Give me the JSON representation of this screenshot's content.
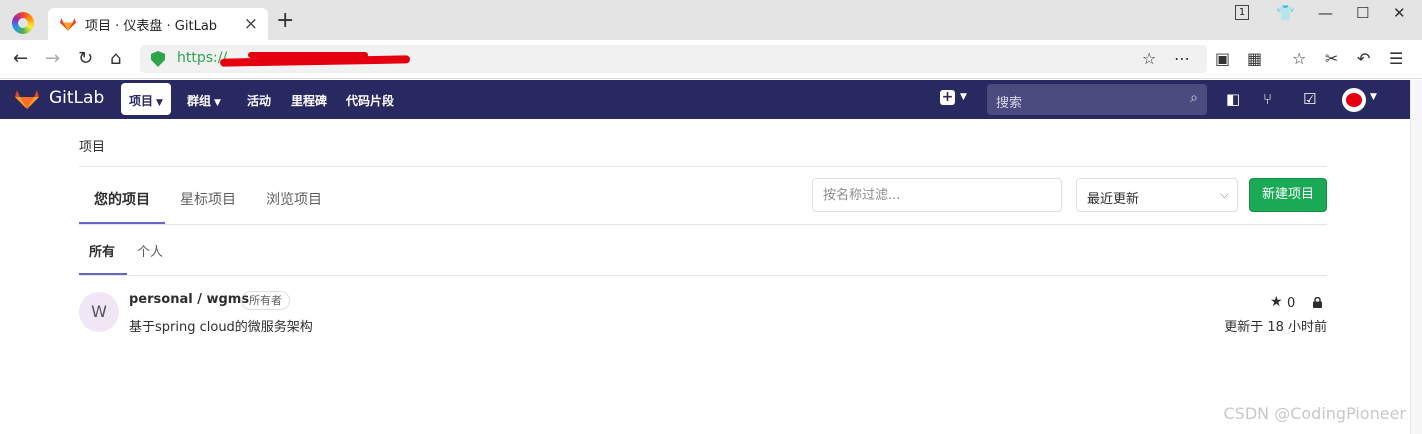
{
  "browser": {
    "tab_title": "项目 · 仪表盘 · GitLab",
    "url": "https://",
    "window_badge": "1"
  },
  "gitlab_nav": {
    "brand": "GitLab",
    "items": [
      "项目",
      "群组",
      "活动",
      "里程碑",
      "代码片段"
    ],
    "search_placeholder": "搜索"
  },
  "page": {
    "breadcrumb": "项目",
    "tabs": [
      "您的项目",
      "星标项目",
      "浏览项目"
    ],
    "filter_placeholder": "按名称过滤...",
    "sort_value": "最近更新",
    "new_project_label": "新建项目",
    "subtabs": [
      "所有",
      "个人"
    ]
  },
  "projects": [
    {
      "avatar_letter": "W",
      "name": "personal / wgms",
      "role": "所有者",
      "description": "基于spring cloud的微服务架构",
      "stars": "0",
      "updated": "更新于 18 小时前"
    }
  ],
  "watermark": "CSDN @CodingPioneer",
  "colors": {
    "navbar": "#292961",
    "accent_underline": "#6666c4",
    "new_project_button": "#1aaa55",
    "secure_url": "#2da44e"
  }
}
